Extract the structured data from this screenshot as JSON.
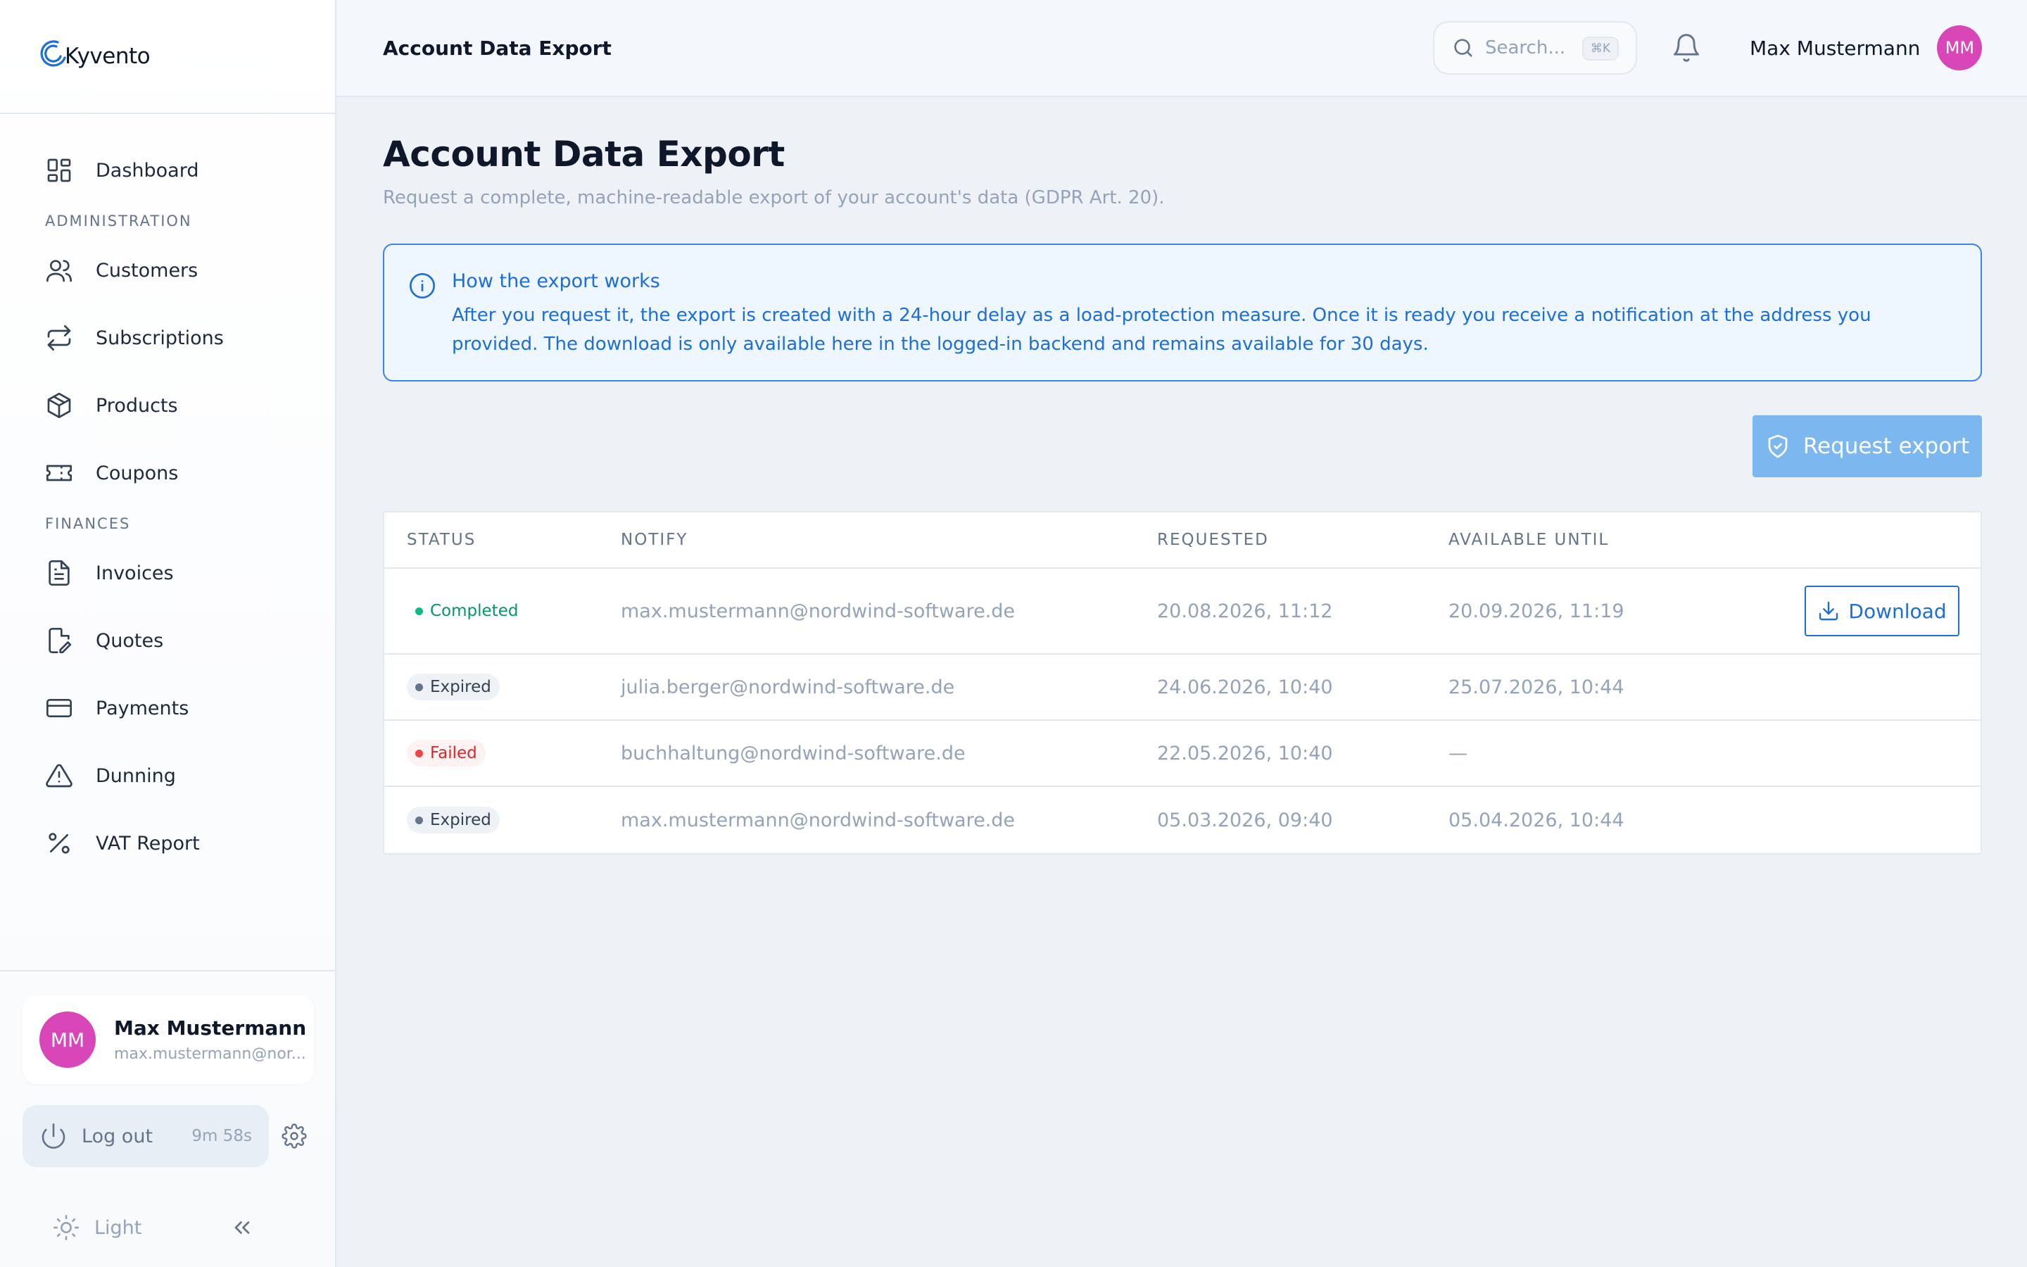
{
  "brand": {
    "name": "Kyvento",
    "accent": "#1d6ed8"
  },
  "sidebar": {
    "dashboard": {
      "label": "Dashboard",
      "icon": "dashboard-icon"
    },
    "sections": [
      {
        "title": "ADMINISTRATION",
        "items": [
          {
            "label": "Customers",
            "icon": "users-icon"
          },
          {
            "label": "Subscriptions",
            "icon": "repeat-icon"
          },
          {
            "label": "Products",
            "icon": "package-icon"
          },
          {
            "label": "Coupons",
            "icon": "ticket-icon"
          }
        ]
      },
      {
        "title": "FINANCES",
        "items": [
          {
            "label": "Invoices",
            "icon": "file-text-icon"
          },
          {
            "label": "Quotes",
            "icon": "file-edit-icon"
          },
          {
            "label": "Payments",
            "icon": "credit-card-icon"
          },
          {
            "label": "Dunning",
            "icon": "alert-triangle-icon"
          },
          {
            "label": "VAT Report",
            "icon": "percent-icon"
          }
        ]
      }
    ],
    "user": {
      "initials": "MM",
      "name": "Max Mustermann",
      "email": "max.mustermann@nor..."
    },
    "logout": {
      "label": "Log out",
      "timer": "9m 58s"
    },
    "theme": {
      "label": "Light"
    }
  },
  "topbar": {
    "title": "Account Data Export",
    "search": {
      "placeholder": "Search...",
      "shortcut": "⌘K"
    },
    "user": {
      "name": "Max Mustermann",
      "initials": "MM"
    }
  },
  "page": {
    "title": "Account Data Export",
    "subtitle": "Request a complete, machine-readable export of your account's data (GDPR Art. 20).",
    "info": {
      "title": "How the export works",
      "text": "After you request it, the export is created with a 24-hour delay as a load-protection measure. Once it is ready you receive a notification at the address you provided. The download is only available here in the logged-in backend and remains available for 30 days."
    },
    "request_button": "Request export"
  },
  "table": {
    "headers": {
      "status": "STATUS",
      "notify": "NOTIFY",
      "requested": "REQUESTED",
      "until": "AVAILABLE UNTIL"
    },
    "rows": [
      {
        "status": "Completed",
        "notify": "max.mustermann@nordwind-software.de",
        "requested": "20.08.2026, 11:12",
        "until": "20.09.2026, 11:19",
        "action": "Download"
      },
      {
        "status": "Expired",
        "notify": "julia.berger@nordwind-software.de",
        "requested": "24.06.2026, 10:40",
        "until": "25.07.2026, 10:44"
      },
      {
        "status": "Failed",
        "notify": "buchhaltung@nordwind-software.de",
        "requested": "22.05.2026, 10:40",
        "until": "—"
      },
      {
        "status": "Expired",
        "notify": "max.mustermann@nordwind-software.de",
        "requested": "05.03.2026, 09:40",
        "until": "05.04.2026, 10:44"
      }
    ]
  },
  "colors": {
    "completed": "#10b981",
    "expired": "#64748b",
    "failed": "#ef4444",
    "request_button": "#7cb7f0",
    "avatar": "#d946b8"
  }
}
